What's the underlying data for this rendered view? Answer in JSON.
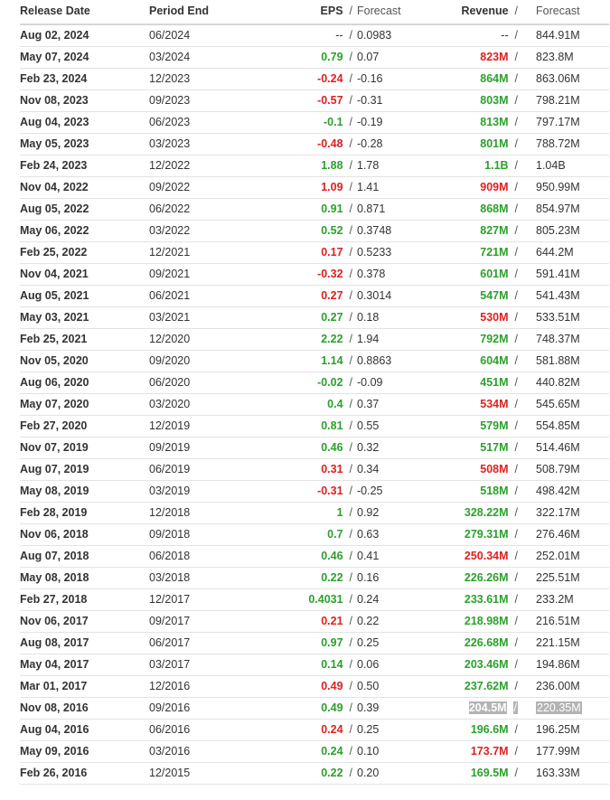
{
  "headers": {
    "release_date": "Release Date",
    "period_end": "Period End",
    "eps": "EPS",
    "eps_forecast": "Forecast",
    "revenue": "Revenue",
    "revenue_forecast": "Forecast",
    "separator": "/"
  },
  "colors": {
    "positive": "#2ca02c",
    "negative": "#e02020",
    "highlight": "#b3b3b3"
  },
  "rows": [
    {
      "date": "Aug 02, 2024",
      "period": "06/2024",
      "eps": "--",
      "eps_f": "0.0983",
      "rev": "--",
      "rev_f": "844.91M",
      "eps_s": "neu",
      "rev_s": "neu"
    },
    {
      "date": "May 07, 2024",
      "period": "03/2024",
      "eps": "0.79",
      "eps_f": "0.07",
      "rev": "823M",
      "rev_f": "823.8M",
      "eps_s": "pos",
      "rev_s": "neg"
    },
    {
      "date": "Feb 23, 2024",
      "period": "12/2023",
      "eps": "-0.24",
      "eps_f": "-0.16",
      "rev": "864M",
      "rev_f": "863.06M",
      "eps_s": "neg",
      "rev_s": "pos"
    },
    {
      "date": "Nov 08, 2023",
      "period": "09/2023",
      "eps": "-0.57",
      "eps_f": "-0.31",
      "rev": "803M",
      "rev_f": "798.21M",
      "eps_s": "neg",
      "rev_s": "pos"
    },
    {
      "date": "Aug 04, 2023",
      "period": "06/2023",
      "eps": "-0.1",
      "eps_f": "-0.19",
      "rev": "813M",
      "rev_f": "797.17M",
      "eps_s": "pos",
      "rev_s": "pos"
    },
    {
      "date": "May 05, 2023",
      "period": "03/2023",
      "eps": "-0.48",
      "eps_f": "-0.28",
      "rev": "801M",
      "rev_f": "788.72M",
      "eps_s": "neg",
      "rev_s": "pos"
    },
    {
      "date": "Feb 24, 2023",
      "period": "12/2022",
      "eps": "1.88",
      "eps_f": "1.78",
      "rev": "1.1B",
      "rev_f": "1.04B",
      "eps_s": "pos",
      "rev_s": "pos"
    },
    {
      "date": "Nov 04, 2022",
      "period": "09/2022",
      "eps": "1.09",
      "eps_f": "1.41",
      "rev": "909M",
      "rev_f": "950.99M",
      "eps_s": "neg",
      "rev_s": "neg"
    },
    {
      "date": "Aug 05, 2022",
      "period": "06/2022",
      "eps": "0.91",
      "eps_f": "0.871",
      "rev": "868M",
      "rev_f": "854.97M",
      "eps_s": "pos",
      "rev_s": "pos"
    },
    {
      "date": "May 06, 2022",
      "period": "03/2022",
      "eps": "0.52",
      "eps_f": "0.3748",
      "rev": "827M",
      "rev_f": "805.23M",
      "eps_s": "pos",
      "rev_s": "pos"
    },
    {
      "date": "Feb 25, 2022",
      "period": "12/2021",
      "eps": "0.17",
      "eps_f": "0.5233",
      "rev": "721M",
      "rev_f": "644.2M",
      "eps_s": "neg",
      "rev_s": "pos"
    },
    {
      "date": "Nov 04, 2021",
      "period": "09/2021",
      "eps": "-0.32",
      "eps_f": "0.378",
      "rev": "601M",
      "rev_f": "591.41M",
      "eps_s": "neg",
      "rev_s": "pos"
    },
    {
      "date": "Aug 05, 2021",
      "period": "06/2021",
      "eps": "0.27",
      "eps_f": "0.3014",
      "rev": "547M",
      "rev_f": "541.43M",
      "eps_s": "neg",
      "rev_s": "pos"
    },
    {
      "date": "May 03, 2021",
      "period": "03/2021",
      "eps": "0.27",
      "eps_f": "0.18",
      "rev": "530M",
      "rev_f": "533.51M",
      "eps_s": "pos",
      "rev_s": "neg"
    },
    {
      "date": "Feb 25, 2021",
      "period": "12/2020",
      "eps": "2.22",
      "eps_f": "1.94",
      "rev": "792M",
      "rev_f": "748.37M",
      "eps_s": "pos",
      "rev_s": "pos"
    },
    {
      "date": "Nov 05, 2020",
      "period": "09/2020",
      "eps": "1.14",
      "eps_f": "0.8863",
      "rev": "604M",
      "rev_f": "581.88M",
      "eps_s": "pos",
      "rev_s": "pos"
    },
    {
      "date": "Aug 06, 2020",
      "period": "06/2020",
      "eps": "-0.02",
      "eps_f": "-0.09",
      "rev": "451M",
      "rev_f": "440.82M",
      "eps_s": "pos",
      "rev_s": "pos"
    },
    {
      "date": "May 07, 2020",
      "period": "03/2020",
      "eps": "0.4",
      "eps_f": "0.37",
      "rev": "534M",
      "rev_f": "545.65M",
      "eps_s": "pos",
      "rev_s": "neg"
    },
    {
      "date": "Feb 27, 2020",
      "period": "12/2019",
      "eps": "0.81",
      "eps_f": "0.55",
      "rev": "579M",
      "rev_f": "554.85M",
      "eps_s": "pos",
      "rev_s": "pos"
    },
    {
      "date": "Nov 07, 2019",
      "period": "09/2019",
      "eps": "0.46",
      "eps_f": "0.32",
      "rev": "517M",
      "rev_f": "514.46M",
      "eps_s": "pos",
      "rev_s": "pos"
    },
    {
      "date": "Aug 07, 2019",
      "period": "06/2019",
      "eps": "0.31",
      "eps_f": "0.34",
      "rev": "508M",
      "rev_f": "508.79M",
      "eps_s": "neg",
      "rev_s": "neg"
    },
    {
      "date": "May 08, 2019",
      "period": "03/2019",
      "eps": "-0.31",
      "eps_f": "-0.25",
      "rev": "518M",
      "rev_f": "498.42M",
      "eps_s": "neg",
      "rev_s": "pos"
    },
    {
      "date": "Feb 28, 2019",
      "period": "12/2018",
      "eps": "1",
      "eps_f": "0.92",
      "rev": "328.22M",
      "rev_f": "322.17M",
      "eps_s": "pos",
      "rev_s": "pos"
    },
    {
      "date": "Nov 06, 2018",
      "period": "09/2018",
      "eps": "0.7",
      "eps_f": "0.63",
      "rev": "279.31M",
      "rev_f": "276.46M",
      "eps_s": "pos",
      "rev_s": "pos"
    },
    {
      "date": "Aug 07, 2018",
      "period": "06/2018",
      "eps": "0.46",
      "eps_f": "0.41",
      "rev": "250.34M",
      "rev_f": "252.01M",
      "eps_s": "pos",
      "rev_s": "neg"
    },
    {
      "date": "May 08, 2018",
      "period": "03/2018",
      "eps": "0.22",
      "eps_f": "0.16",
      "rev": "226.26M",
      "rev_f": "225.51M",
      "eps_s": "pos",
      "rev_s": "pos"
    },
    {
      "date": "Feb 27, 2018",
      "period": "12/2017",
      "eps": "0.4031",
      "eps_f": "0.24",
      "rev": "233.61M",
      "rev_f": "233.2M",
      "eps_s": "pos",
      "rev_s": "pos"
    },
    {
      "date": "Nov 06, 2017",
      "period": "09/2017",
      "eps": "0.21",
      "eps_f": "0.22",
      "rev": "218.98M",
      "rev_f": "216.51M",
      "eps_s": "neg",
      "rev_s": "pos"
    },
    {
      "date": "Aug 08, 2017",
      "period": "06/2017",
      "eps": "0.97",
      "eps_f": "0.25",
      "rev": "226.68M",
      "rev_f": "221.15M",
      "eps_s": "pos",
      "rev_s": "pos"
    },
    {
      "date": "May 04, 2017",
      "period": "03/2017",
      "eps": "0.14",
      "eps_f": "0.06",
      "rev": "203.46M",
      "rev_f": "194.86M",
      "eps_s": "pos",
      "rev_s": "pos"
    },
    {
      "date": "Mar 01, 2017",
      "period": "12/2016",
      "eps": "0.49",
      "eps_f": "0.50",
      "rev": "237.62M",
      "rev_f": "236.00M",
      "eps_s": "neg",
      "rev_s": "pos"
    },
    {
      "date": "Nov 08, 2016",
      "period": "09/2016",
      "eps": "0.49",
      "eps_f": "0.39",
      "rev": "204.5M",
      "rev_f": "220.35M",
      "eps_s": "pos",
      "rev_s": "hl"
    },
    {
      "date": "Aug 04, 2016",
      "period": "06/2016",
      "eps": "0.24",
      "eps_f": "0.25",
      "rev": "196.6M",
      "rev_f": "196.25M",
      "eps_s": "neg",
      "rev_s": "pos"
    },
    {
      "date": "May 09, 2016",
      "period": "03/2016",
      "eps": "0.24",
      "eps_f": "0.10",
      "rev": "173.7M",
      "rev_f": "177.99M",
      "eps_s": "pos",
      "rev_s": "neg"
    },
    {
      "date": "Feb 26, 2016",
      "period": "12/2015",
      "eps": "0.22",
      "eps_f": "0.20",
      "rev": "169.5M",
      "rev_f": "163.33M",
      "eps_s": "pos",
      "rev_s": "pos"
    }
  ]
}
